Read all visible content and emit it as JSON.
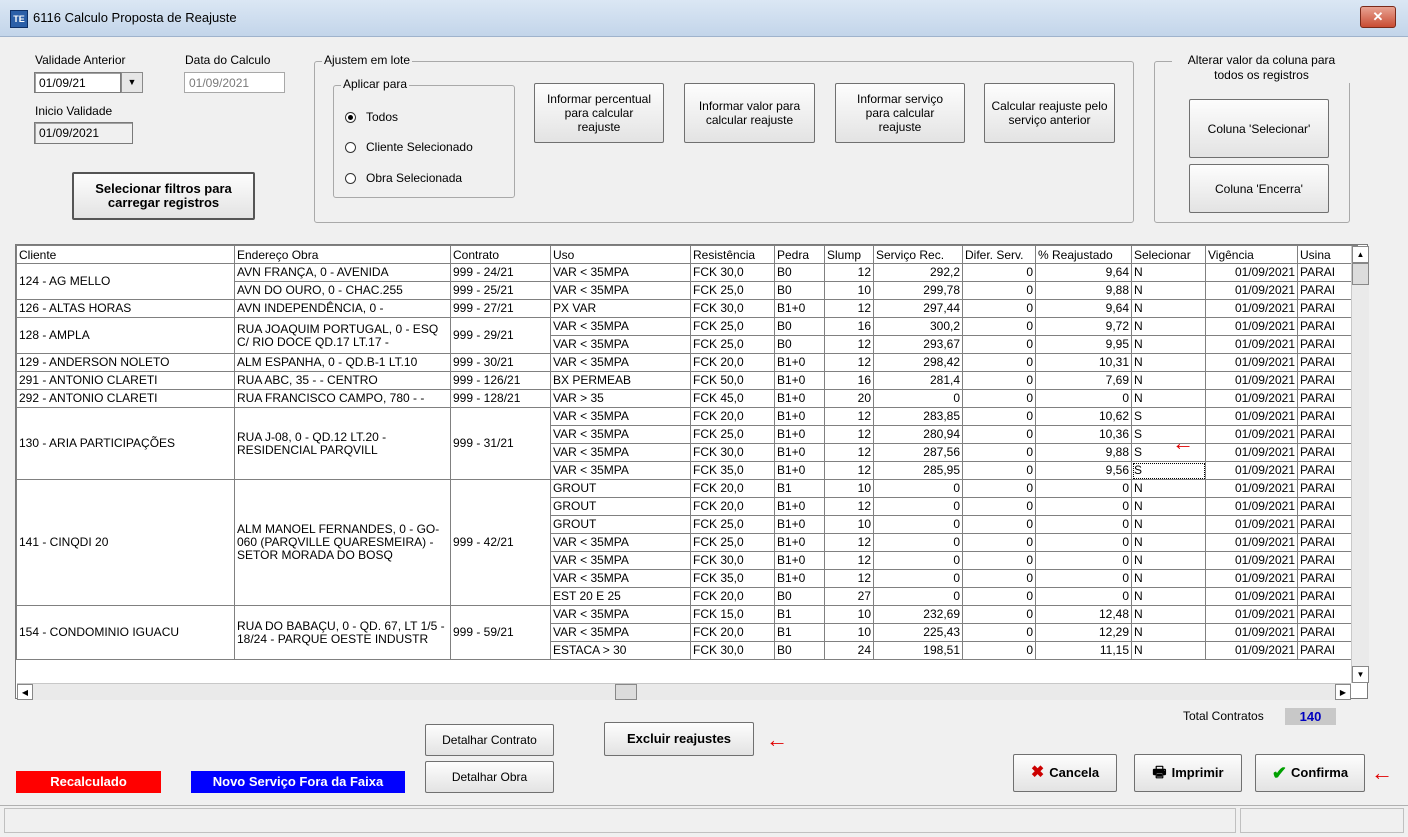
{
  "window": {
    "title": "6116 Calculo Proposta de Reajuste",
    "app_icon": "app-icon",
    "close_glyph": "✕"
  },
  "left": {
    "validade_anterior_label": "Validade Anterior",
    "validade_anterior_value": "01/09/21",
    "data_calculo_label": "Data do Calculo",
    "data_calculo_value": "01/09/2021",
    "inicio_validade_label": "Inicio Validade",
    "inicio_validade_value": "01/09/2021",
    "filtros_button": "Selecionar filtros para carregar registros"
  },
  "ajustem": {
    "legend": "Ajustem em lote",
    "aplicar_legend": "Aplicar para",
    "options": [
      "Todos",
      "Cliente Selecionado",
      "Obra Selecionada"
    ],
    "selected": "Todos",
    "buttons": [
      "Informar percentual para calcular reajuste",
      "Informar valor para calcular reajuste",
      "Informar serviço para calcular reajuste",
      "Calcular reajuste pelo serviço anterior"
    ]
  },
  "alterar": {
    "legend": "Alterar valor da coluna para todos os registros",
    "btn_selecionar": "Coluna 'Selecionar'",
    "btn_encerra": "Coluna 'Encerra'"
  },
  "grid": {
    "columns": [
      "Cliente",
      "Endereço Obra",
      "Contrato",
      "Uso",
      "Resistência",
      "Pedra",
      "Slump",
      "Serviço Rec.",
      "Difer. Serv.",
      "% Reajustado",
      "Selecionar",
      "Vigência",
      "Usina"
    ],
    "groups": [
      {
        "cliente": "124 - AG MELLO",
        "sub": [
          {
            "endereco": "AVN FRANÇA, 0 - AVENIDA",
            "contrato": "999 - 24/21",
            "rows": [
              [
                "VAR < 35MPA",
                "FCK 30,0",
                "B0",
                "12",
                "292,2",
                "0",
                "9,64",
                "N",
                "01/09/2021",
                "PARAI"
              ]
            ]
          },
          {
            "endereco": "AVN DO OURO, 0 - CHAC.255",
            "contrato": "999 - 25/21",
            "rows": [
              [
                "VAR < 35MPA",
                "FCK 25,0",
                "B0",
                "10",
                "299,78",
                "0",
                "9,88",
                "N",
                "01/09/2021",
                "PARAI"
              ]
            ]
          }
        ]
      },
      {
        "cliente": "126 - ALTAS HORAS",
        "sub": [
          {
            "endereco": "AVN INDEPENDÊNCIA, 0 -",
            "contrato": "999 - 27/21",
            "rows": [
              [
                "PX VAR",
                "FCK 30,0",
                "B1+0",
                "12",
                "297,44",
                "0",
                "9,64",
                "N",
                "01/09/2021",
                "PARAI"
              ]
            ]
          }
        ]
      },
      {
        "cliente": "128 - AMPLA",
        "sub": [
          {
            "endereco": "RUA JOAQUIM PORTUGAL, 0 - ESQ C/ RIO DOCE QD.17 LT.17 -",
            "contrato": "999 - 29/21",
            "rows": [
              [
                "VAR < 35MPA",
                "FCK 25,0",
                "B0",
                "16",
                "300,2",
                "0",
                "9,72",
                "N",
                "01/09/2021",
                "PARAI"
              ],
              [
                "VAR < 35MPA",
                "FCK 25,0",
                "B0",
                "12",
                "293,67",
                "0",
                "9,95",
                "N",
                "01/09/2021",
                "PARAI"
              ]
            ]
          }
        ]
      },
      {
        "cliente": "129 - ANDERSON NOLETO",
        "sub": [
          {
            "endereco": "ALM ESPANHA, 0 - QD.B-1 LT.10",
            "contrato": "999 - 30/21",
            "rows": [
              [
                "VAR < 35MPA",
                "FCK 20,0",
                "B1+0",
                "12",
                "298,42",
                "0",
                "10,31",
                "N",
                "01/09/2021",
                "PARAI"
              ]
            ]
          }
        ]
      },
      {
        "cliente": "291 - ANTONIO CLARETI",
        "sub": [
          {
            "endereco": "RUA ABC, 35 - - CENTRO",
            "contrato": "999 - 126/21",
            "rows": [
              [
                "BX PERMEAB",
                "FCK 50,0",
                "B1+0",
                "16",
                "281,4",
                "0",
                "7,69",
                "N",
                "01/09/2021",
                "PARAI"
              ]
            ]
          }
        ]
      },
      {
        "cliente": "292 - ANTONIO CLARETI",
        "sub": [
          {
            "endereco": "RUA FRANCISCO CAMPO, 780 - -",
            "contrato": "999 - 128/21",
            "rows": [
              [
                "VAR > 35",
                "FCK 45,0",
                "B1+0",
                "20",
                "0",
                "0",
                "0",
                "N",
                "01/09/2021",
                "PARAI"
              ]
            ]
          }
        ]
      },
      {
        "cliente": "130 - ARIA PARTICIPAÇÕES",
        "sub": [
          {
            "endereco": "RUA J-08, 0 - QD.12 LT.20 - RESIDENCIAL PARQVILL",
            "contrato": "999 - 31/21",
            "rows": [
              [
                "VAR < 35MPA",
                "FCK 20,0",
                "B1+0",
                "12",
                "283,85",
                "0",
                "10,62",
                "S",
                "01/09/2021",
                "PARAI"
              ],
              [
                "VAR < 35MPA",
                "FCK 25,0",
                "B1+0",
                "12",
                "280,94",
                "0",
                "10,36",
                "S",
                "01/09/2021",
                "PARAI"
              ],
              [
                "VAR < 35MPA",
                "FCK 30,0",
                "B1+0",
                "12",
                "287,56",
                "0",
                "9,88",
                "S",
                "01/09/2021",
                "PARAI"
              ],
              [
                "VAR < 35MPA",
                "FCK 35,0",
                "B1+0",
                "12",
                "285,95",
                "0",
                "9,56",
                "S",
                "01/09/2021",
                "PARAI"
              ]
            ]
          }
        ]
      },
      {
        "cliente": "141 - CINQDI 20",
        "sub": [
          {
            "endereco": "ALM MANOEL FERNANDES, 0 - GO-060 (PARQVILLE QUARESMEIRA) - SETOR MORADA DO BOSQ",
            "contrato": "999 - 42/21",
            "rows": [
              [
                "GROUT",
                "FCK 20,0",
                "B1",
                "10",
                "0",
                "0",
                "0",
                "N",
                "01/09/2021",
                "PARAI"
              ],
              [
                "GROUT",
                "FCK 20,0",
                "B1+0",
                "12",
                "0",
                "0",
                "0",
                "N",
                "01/09/2021",
                "PARAI"
              ],
              [
                "GROUT",
                "FCK 25,0",
                "B1+0",
                "10",
                "0",
                "0",
                "0",
                "N",
                "01/09/2021",
                "PARAI"
              ],
              [
                "VAR < 35MPA",
                "FCK 25,0",
                "B1+0",
                "12",
                "0",
                "0",
                "0",
                "N",
                "01/09/2021",
                "PARAI"
              ],
              [
                "VAR < 35MPA",
                "FCK 30,0",
                "B1+0",
                "12",
                "0",
                "0",
                "0",
                "N",
                "01/09/2021",
                "PARAI"
              ],
              [
                "VAR < 35MPA",
                "FCK 35,0",
                "B1+0",
                "12",
                "0",
                "0",
                "0",
                "N",
                "01/09/2021",
                "PARAI"
              ],
              [
                "EST 20 E 25",
                "FCK 20,0",
                "B0",
                "27",
                "0",
                "0",
                "0",
                "N",
                "01/09/2021",
                "PARAI"
              ]
            ]
          }
        ]
      },
      {
        "cliente": "154 - CONDOMINIO IGUACU",
        "sub": [
          {
            "endereco": "RUA DO BABAÇU, 0 - QD. 67, LT 1/5 - 18/24 - PARQUE OESTE INDUSTR",
            "contrato": "999 - 59/21",
            "rows": [
              [
                "VAR < 35MPA",
                "FCK 15,0",
                "B1",
                "10",
                "232,69",
                "0",
                "12,48",
                "N",
                "01/09/2021",
                "PARAI"
              ],
              [
                "VAR < 35MPA",
                "FCK 20,0",
                "B1",
                "10",
                "225,43",
                "0",
                "12,29",
                "N",
                "01/09/2021",
                "PARAI"
              ],
              [
                "ESTACA > 30",
                "FCK 30,0",
                "B0",
                "24",
                "198,51",
                "0",
                "11,15",
                "N",
                "01/09/2021",
                "PARAI"
              ]
            ]
          }
        ]
      }
    ]
  },
  "bottom": {
    "total_label": "Total Contratos",
    "total_value": "140",
    "detalhar_contrato": "Detalhar Contrato",
    "detalhar_obra": "Detalhar Obra",
    "excluir": "Excluir reajustes",
    "legend_recalc": "Recalculado",
    "legend_novo": "Novo Serviço Fora da Faixa",
    "cancela": "Cancela",
    "imprimir": "Imprimir",
    "confirma": "Confirma",
    "arrow": "←"
  },
  "colors": {
    "recalc": "#ff0000",
    "novo": "#0000ff",
    "total": "#0000c0",
    "arrow": "#e00000"
  }
}
